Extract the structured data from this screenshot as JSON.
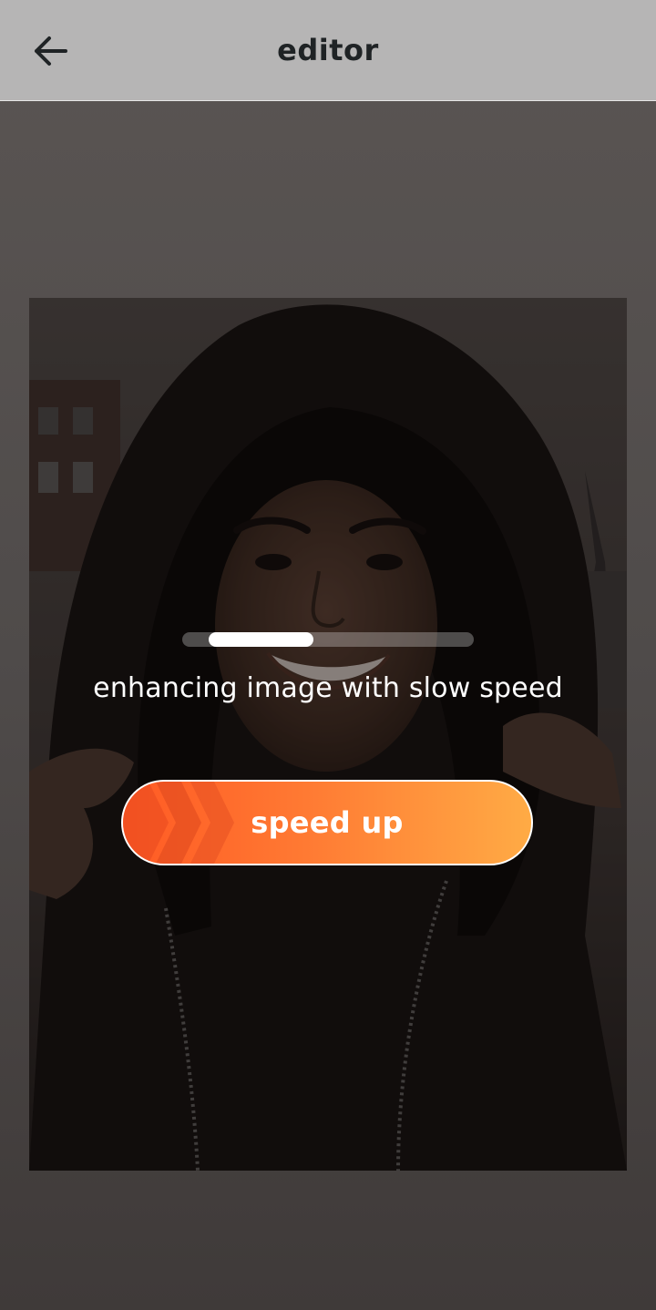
{
  "header": {
    "title": "editor",
    "back_icon": "arrow-left-icon"
  },
  "photo": {
    "subject": "portrait-photo"
  },
  "progress": {
    "fraction_start": 0.09,
    "fraction_end": 0.45
  },
  "status": {
    "message": "enhancing image with slow speed"
  },
  "speed_button": {
    "label": "speed up",
    "icon": "chevrons-right-icon"
  },
  "colors": {
    "header_bg": "#b6b5b5",
    "accent_start": "#ff5a24",
    "accent_end": "#ffab45"
  }
}
